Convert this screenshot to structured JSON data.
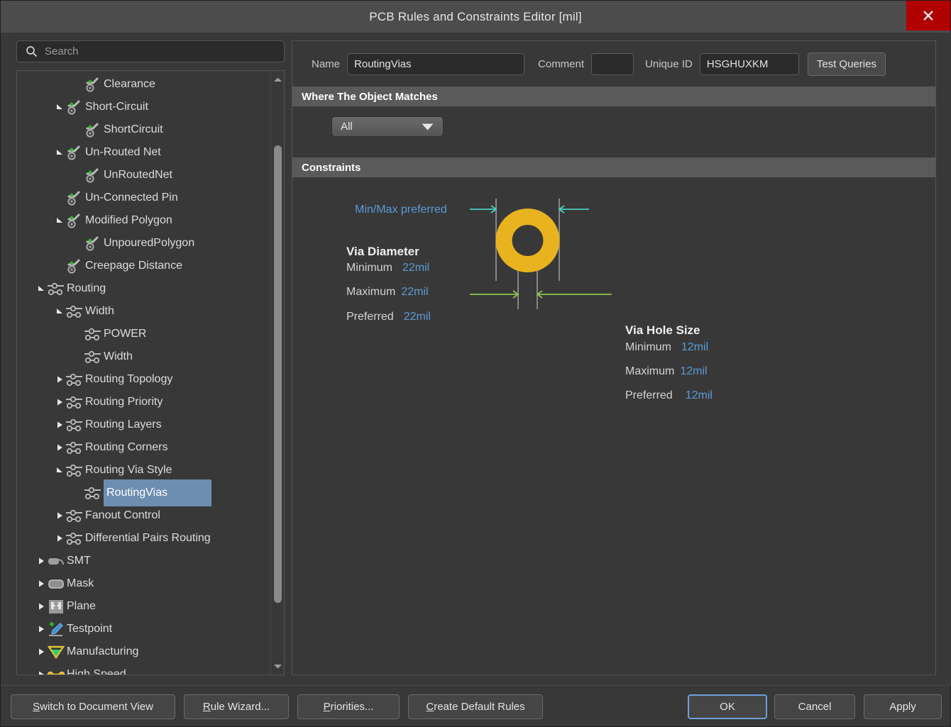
{
  "window": {
    "title": "PCB Rules and Constraints Editor [mil]",
    "close_label": "close-icon"
  },
  "search": {
    "placeholder": "Search",
    "value": ""
  },
  "tree": {
    "items": [
      {
        "label": "Clearance",
        "indent": 3,
        "twisty": "none",
        "icon": "rule-icon",
        "selected": false
      },
      {
        "label": "Short-Circuit",
        "indent": 2,
        "twisty": "expanded",
        "icon": "rule-icon",
        "selected": false
      },
      {
        "label": "ShortCircuit",
        "indent": 3,
        "twisty": "none",
        "icon": "rule-icon",
        "selected": false
      },
      {
        "label": "Un-Routed Net",
        "indent": 2,
        "twisty": "expanded",
        "icon": "rule-icon",
        "selected": false
      },
      {
        "label": "UnRoutedNet",
        "indent": 3,
        "twisty": "none",
        "icon": "rule-icon",
        "selected": false
      },
      {
        "label": "Un-Connected Pin",
        "indent": 2,
        "twisty": "none",
        "icon": "rule-icon",
        "selected": false
      },
      {
        "label": "Modified Polygon",
        "indent": 2,
        "twisty": "expanded",
        "icon": "rule-icon",
        "selected": false
      },
      {
        "label": "UnpouredPolygon",
        "indent": 3,
        "twisty": "none",
        "icon": "rule-icon",
        "selected": false
      },
      {
        "label": "Creepage Distance",
        "indent": 2,
        "twisty": "none",
        "icon": "rule-icon",
        "selected": false
      },
      {
        "label": "Routing",
        "indent": 1,
        "twisty": "expanded",
        "icon": "routing-icon",
        "selected": false
      },
      {
        "label": "Width",
        "indent": 2,
        "twisty": "expanded",
        "icon": "routing-icon",
        "selected": false
      },
      {
        "label": "POWER",
        "indent": 3,
        "twisty": "none",
        "icon": "routing-icon",
        "selected": false
      },
      {
        "label": "Width",
        "indent": 3,
        "twisty": "none",
        "icon": "routing-icon",
        "selected": false
      },
      {
        "label": "Routing Topology",
        "indent": 2,
        "twisty": "collapsed",
        "icon": "routing-icon",
        "selected": false
      },
      {
        "label": "Routing Priority",
        "indent": 2,
        "twisty": "collapsed",
        "icon": "routing-icon",
        "selected": false
      },
      {
        "label": "Routing Layers",
        "indent": 2,
        "twisty": "collapsed",
        "icon": "routing-icon",
        "selected": false
      },
      {
        "label": "Routing Corners",
        "indent": 2,
        "twisty": "collapsed",
        "icon": "routing-icon",
        "selected": false
      },
      {
        "label": "Routing Via Style",
        "indent": 2,
        "twisty": "expanded",
        "icon": "routing-icon",
        "selected": false
      },
      {
        "label": "RoutingVias",
        "indent": 3,
        "twisty": "none",
        "icon": "routing-icon",
        "selected": true
      },
      {
        "label": "Fanout Control",
        "indent": 2,
        "twisty": "collapsed",
        "icon": "routing-icon",
        "selected": false
      },
      {
        "label": "Differential Pairs Routing",
        "indent": 2,
        "twisty": "collapsed",
        "icon": "routing-icon",
        "selected": false
      },
      {
        "label": "SMT",
        "indent": 1,
        "twisty": "collapsed",
        "icon": "smt-icon",
        "selected": false
      },
      {
        "label": "Mask",
        "indent": 1,
        "twisty": "collapsed",
        "icon": "mask-icon",
        "selected": false
      },
      {
        "label": "Plane",
        "indent": 1,
        "twisty": "collapsed",
        "icon": "plane-icon",
        "selected": false
      },
      {
        "label": "Testpoint",
        "indent": 1,
        "twisty": "collapsed",
        "icon": "testpoint-icon",
        "selected": false
      },
      {
        "label": "Manufacturing",
        "indent": 1,
        "twisty": "collapsed",
        "icon": "manufacturing-icon",
        "selected": false
      },
      {
        "label": "High Speed",
        "indent": 1,
        "twisty": "collapsed",
        "icon": "highspeed-icon",
        "selected": false
      }
    ]
  },
  "form": {
    "name_label": "Name",
    "name_value": "RoutingVias",
    "comment_label": "Comment",
    "comment_value": "",
    "unique_id_label": "Unique ID",
    "unique_id_value": "HSGHUXKM",
    "test_queries_label": "Test Queries"
  },
  "sections": {
    "where_matches": "Where The Object Matches",
    "constraints": "Constraints"
  },
  "scope": {
    "selected": "All",
    "options": [
      "All"
    ]
  },
  "constraints": {
    "minmax_link": "Min/Max preferred",
    "via_diameter": {
      "title": "Via Diameter",
      "minimum_label": "Minimum",
      "minimum_value": "22mil",
      "maximum_label": "Maximum",
      "maximum_value": "22mil",
      "preferred_label": "Preferred",
      "preferred_value": "22mil"
    },
    "via_hole_size": {
      "title": "Via Hole Size",
      "minimum_label": "Minimum",
      "minimum_value": "12mil",
      "maximum_label": "Maximum",
      "maximum_value": "12mil",
      "preferred_label": "Preferred",
      "preferred_value": "12mil"
    }
  },
  "footer": {
    "switch_doc_view": "Switch to Document View",
    "switch_doc_view_accel": "S",
    "rule_wizard": "Rule Wizard...",
    "rule_wizard_accel": "R",
    "priorities": "Priorities...",
    "priorities_accel": "P",
    "create_default_rules": "Create Default Rules",
    "create_default_rules_accel": "C",
    "ok": "OK",
    "cancel": "Cancel",
    "apply": "Apply"
  },
  "colors": {
    "via_copper": "#e8b31e",
    "via_diameter_arrow": "#4ecdc4",
    "via_hole_arrow": "#8cc152",
    "value_blue": "#5b9bd5",
    "selection_blue": "#6d8eb0",
    "close_red": "#b00000"
  }
}
